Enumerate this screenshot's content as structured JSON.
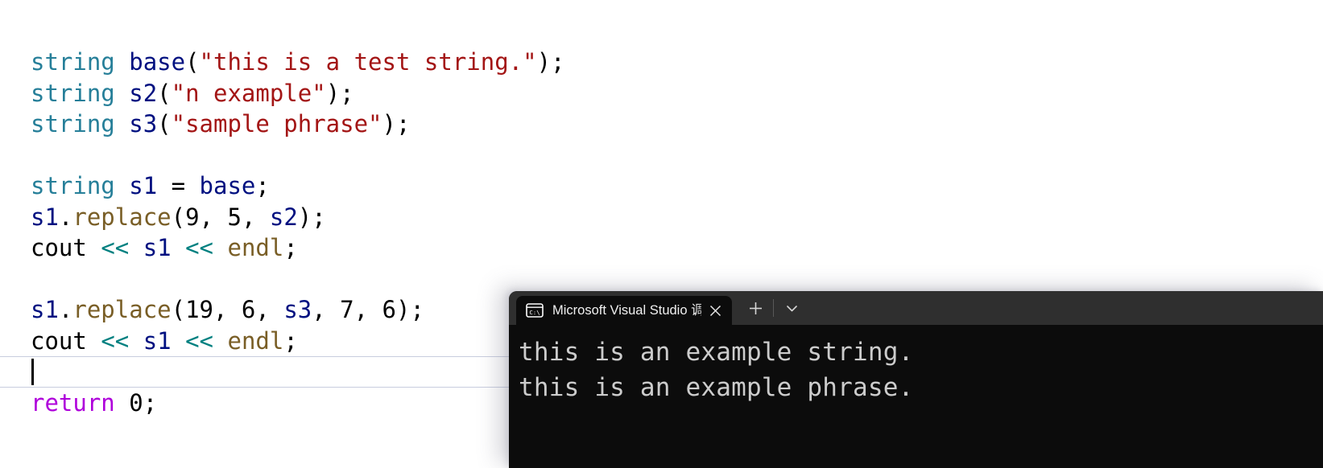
{
  "editor": {
    "name": "code-editor",
    "language": "cpp",
    "theme": "light",
    "colors": {
      "background": "#ffffff",
      "type": "#267f99",
      "variable": "#001080",
      "string": "#a31515",
      "function": "#795e26",
      "operator": "#008080",
      "keyword": "#af00db",
      "plain": "#000000",
      "current_line_border": "#c8cdde",
      "caret": "#000000"
    },
    "lines": [
      {
        "index": 0,
        "text": "string base(\"this is a test string.\");",
        "tokens": [
          {
            "t": "string",
            "c": "t-type"
          },
          {
            "t": " ",
            "c": "t-plain"
          },
          {
            "t": "base",
            "c": "t-var"
          },
          {
            "t": "(",
            "c": "t-punct"
          },
          {
            "t": "\"this is a test string.\"",
            "c": "t-str"
          },
          {
            "t": ");",
            "c": "t-punct"
          }
        ]
      },
      {
        "index": 1,
        "text": "string s2(\"n example\");",
        "tokens": [
          {
            "t": "string",
            "c": "t-type"
          },
          {
            "t": " ",
            "c": "t-plain"
          },
          {
            "t": "s2",
            "c": "t-var"
          },
          {
            "t": "(",
            "c": "t-punct"
          },
          {
            "t": "\"n example\"",
            "c": "t-str"
          },
          {
            "t": ");",
            "c": "t-punct"
          }
        ]
      },
      {
        "index": 2,
        "text": "string s3(\"sample phrase\");",
        "tokens": [
          {
            "t": "string",
            "c": "t-type"
          },
          {
            "t": " ",
            "c": "t-plain"
          },
          {
            "t": "s3",
            "c": "t-var"
          },
          {
            "t": "(",
            "c": "t-punct"
          },
          {
            "t": "\"sample phrase\"",
            "c": "t-str"
          },
          {
            "t": ");",
            "c": "t-punct"
          }
        ]
      },
      {
        "index": 3,
        "text": "",
        "tokens": []
      },
      {
        "index": 4,
        "text": "string s1 = base;",
        "tokens": [
          {
            "t": "string",
            "c": "t-type"
          },
          {
            "t": " ",
            "c": "t-plain"
          },
          {
            "t": "s1",
            "c": "t-var"
          },
          {
            "t": " = ",
            "c": "t-plain"
          },
          {
            "t": "base",
            "c": "t-var"
          },
          {
            "t": ";",
            "c": "t-punct"
          }
        ]
      },
      {
        "index": 5,
        "text": "s1.replace(9, 5, s2);",
        "tokens": [
          {
            "t": "s1",
            "c": "t-var"
          },
          {
            "t": ".",
            "c": "t-plain"
          },
          {
            "t": "replace",
            "c": "t-func"
          },
          {
            "t": "(",
            "c": "t-punct"
          },
          {
            "t": "9",
            "c": "t-num"
          },
          {
            "t": ", ",
            "c": "t-plain"
          },
          {
            "t": "5",
            "c": "t-num"
          },
          {
            "t": ", ",
            "c": "t-plain"
          },
          {
            "t": "s2",
            "c": "t-var"
          },
          {
            "t": ");",
            "c": "t-punct"
          }
        ]
      },
      {
        "index": 6,
        "text": "cout << s1 << endl;",
        "tokens": [
          {
            "t": "cout",
            "c": "t-plain"
          },
          {
            "t": " ",
            "c": "t-plain"
          },
          {
            "t": "<<",
            "c": "t-op"
          },
          {
            "t": " ",
            "c": "t-plain"
          },
          {
            "t": "s1",
            "c": "t-var"
          },
          {
            "t": " ",
            "c": "t-plain"
          },
          {
            "t": "<<",
            "c": "t-op"
          },
          {
            "t": " ",
            "c": "t-plain"
          },
          {
            "t": "endl",
            "c": "t-func"
          },
          {
            "t": ";",
            "c": "t-punct"
          }
        ]
      },
      {
        "index": 7,
        "text": "",
        "tokens": []
      },
      {
        "index": 8,
        "text": "s1.replace(19, 6, s3, 7, 6);",
        "tokens": [
          {
            "t": "s1",
            "c": "t-var"
          },
          {
            "t": ".",
            "c": "t-plain"
          },
          {
            "t": "replace",
            "c": "t-func"
          },
          {
            "t": "(",
            "c": "t-punct"
          },
          {
            "t": "19",
            "c": "t-num"
          },
          {
            "t": ", ",
            "c": "t-plain"
          },
          {
            "t": "6",
            "c": "t-num"
          },
          {
            "t": ", ",
            "c": "t-plain"
          },
          {
            "t": "s3",
            "c": "t-var"
          },
          {
            "t": ", ",
            "c": "t-plain"
          },
          {
            "t": "7",
            "c": "t-num"
          },
          {
            "t": ", ",
            "c": "t-plain"
          },
          {
            "t": "6",
            "c": "t-num"
          },
          {
            "t": ");",
            "c": "t-punct"
          }
        ]
      },
      {
        "index": 9,
        "text": "cout << s1 << endl;",
        "tokens": [
          {
            "t": "cout",
            "c": "t-plain"
          },
          {
            "t": " ",
            "c": "t-plain"
          },
          {
            "t": "<<",
            "c": "t-op"
          },
          {
            "t": " ",
            "c": "t-plain"
          },
          {
            "t": "s1",
            "c": "t-var"
          },
          {
            "t": " ",
            "c": "t-plain"
          },
          {
            "t": "<<",
            "c": "t-op"
          },
          {
            "t": " ",
            "c": "t-plain"
          },
          {
            "t": "endl",
            "c": "t-func"
          },
          {
            "t": ";",
            "c": "t-punct"
          }
        ]
      },
      {
        "index": 10,
        "text": "",
        "tokens": [],
        "current": true
      },
      {
        "index": 11,
        "text": "return 0;",
        "tokens": [
          {
            "t": "return",
            "c": "t-kw"
          },
          {
            "t": " ",
            "c": "t-plain"
          },
          {
            "t": "0",
            "c": "t-num"
          },
          {
            "t": ";",
            "c": "t-punct"
          }
        ]
      }
    ]
  },
  "terminal": {
    "name": "windows-terminal",
    "tab": {
      "title": "Microsoft Visual Studio 调试控制台",
      "icon": "command-prompt-icon",
      "icon_label": "C:\\",
      "close_label": "✕"
    },
    "actions": {
      "new_tab_label": "+",
      "dropdown_label": "⌄"
    },
    "output_lines": [
      "this is an example string.",
      "this is an example phrase."
    ],
    "colors": {
      "background": "#0c0c0c",
      "titlebar": "#2f2f2f",
      "text": "#cccccc"
    }
  }
}
